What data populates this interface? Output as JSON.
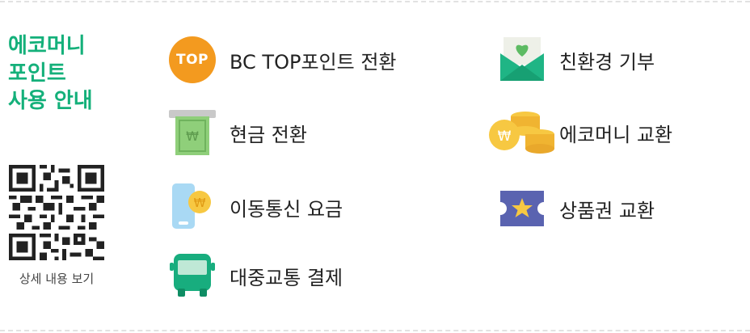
{
  "header": {
    "title_lines": [
      "에코머니",
      "포인트",
      "사용 안내"
    ]
  },
  "qr": {
    "caption": "상세 내용 보기"
  },
  "left_items": [
    {
      "label": "BC TOP포인트 전환",
      "icon": "top-point-icon",
      "badge_text": "TOP"
    },
    {
      "label": "현금 전환",
      "icon": "cash-icon",
      "won_symbol": "₩"
    },
    {
      "label": "이동통신 요금",
      "icon": "mobile-phone-icon",
      "won_symbol": "₩"
    },
    {
      "label": "대중교통 결제",
      "icon": "bus-icon"
    }
  ],
  "right_items": [
    {
      "label": "친환경 기부",
      "icon": "donation-envelope-icon"
    },
    {
      "label": "에코머니 교환",
      "icon": "coins-icon",
      "won_symbol": "₩"
    },
    {
      "label": "상품권 교환",
      "icon": "gift-voucher-icon"
    }
  ],
  "colors": {
    "brand_green": "#14b07a",
    "orange": "#f39a1f",
    "cash_green": "#8fcf7a",
    "coin_yellow": "#f7c842",
    "voucher_purple": "#5a63b0"
  }
}
